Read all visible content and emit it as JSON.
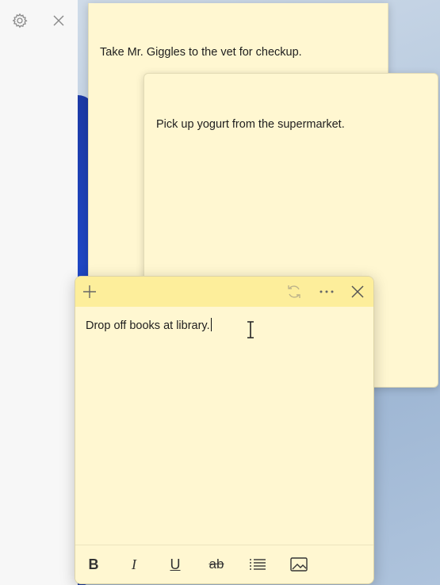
{
  "panel": {
    "settings_icon": "gear-icon",
    "close_icon": "close-icon"
  },
  "notes": [
    {
      "text": "Take Mr. Giggles to the vet for checkup."
    },
    {
      "text": "Pick up yogurt from the supermarket."
    },
    {
      "text": "Drop off books at library."
    }
  ],
  "active_note": {
    "header_buttons": [
      "add-icon",
      "sync-icon",
      "more-icon",
      "close-icon"
    ],
    "format_buttons": {
      "bold": "B",
      "italic": "I",
      "underline": "U",
      "strikethrough": "ab",
      "bullets": "bullet-list-icon",
      "image": "image-icon"
    }
  },
  "colors": {
    "note_body": "#fff7d1",
    "note_header": "#fdee9b"
  }
}
